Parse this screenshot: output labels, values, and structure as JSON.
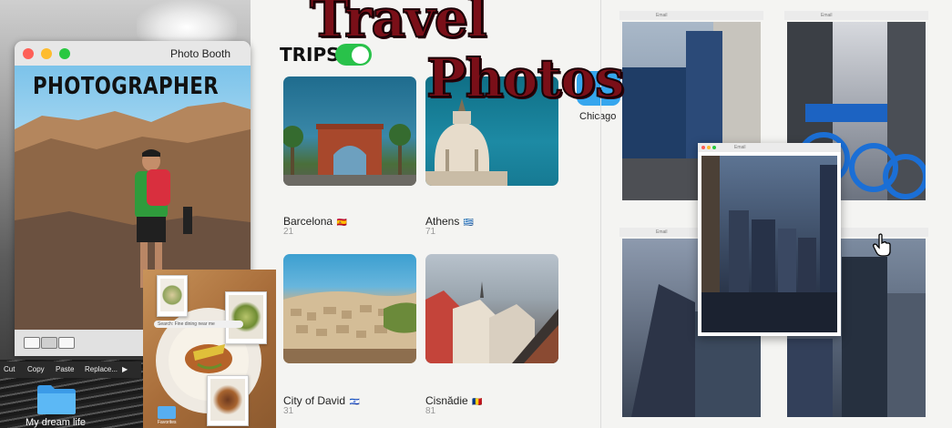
{
  "headline": {
    "line1": "Travel",
    "line2": "Photos"
  },
  "photo_booth": {
    "title": "Photo Booth",
    "label": "PHOTOGRAPHER",
    "toolbar_icons": [
      "grid-view-icon",
      "portrait-view-icon",
      "video-icon"
    ]
  },
  "context_menu": {
    "items": [
      "Cut",
      "Copy",
      "Paste",
      "Replace...",
      "▶"
    ]
  },
  "desktop_folder": {
    "label": "My dream life"
  },
  "food_window": {
    "search_text": "Search: Fine dining near me",
    "folder_label": "Favorites"
  },
  "trips": {
    "label": "TRIPS",
    "toggle_on": true,
    "albums": [
      {
        "name": "Barcelona",
        "flag": "🇪🇸",
        "count": "21"
      },
      {
        "name": "Athens",
        "flag": "🇬🇷",
        "count": "71"
      },
      {
        "name": "City of David",
        "flag": "🇮🇱",
        "count": "31"
      },
      {
        "name": "Cisnădie",
        "flag": "🇷🇴",
        "count": "81"
      }
    ],
    "chicago": {
      "label": "Chicago"
    }
  },
  "gallery": {
    "window_label": "Email"
  },
  "colors": {
    "accent_green": "#29c24a",
    "headline_red": "#7a0f18",
    "folder_blue": "#35a6ee"
  }
}
